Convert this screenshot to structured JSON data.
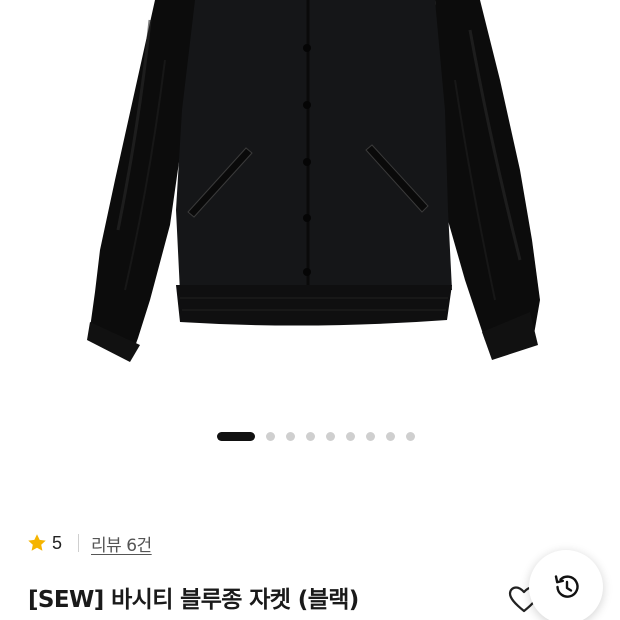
{
  "product": {
    "image_alt": "black varsity jacket with leather sleeves",
    "gallery": {
      "total_images": 9,
      "active_index": 0
    },
    "rating": {
      "score": "5",
      "reviews_label": "리뷰 6건",
      "star_color": "#F5B400"
    },
    "title": "[SEW] 바시티 블루종 자켓 (블랙)"
  },
  "icons": {
    "rating_star": "star-icon",
    "wishlist": "heart-icon",
    "recently_viewed": "history-icon"
  },
  "colors": {
    "jacket_body": "#151618",
    "leather": "#0c0c0c",
    "active_dot": "#111111",
    "inactive_dot": "#cfcfcf"
  }
}
